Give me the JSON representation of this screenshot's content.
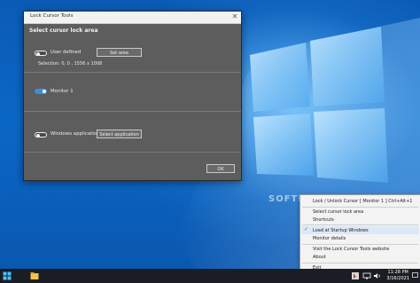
{
  "window": {
    "title": "Lock Cursor Tools",
    "section_title": "Select cursor lock area",
    "rows": {
      "user_defined_label": "User defined",
      "set_area_label": "Set area",
      "selection_text": "Selection: 0, 0 , 1556 x 1008",
      "monitor_label": "Monitor 1",
      "windows_app_label": "Windows application",
      "select_app_label": "Select application"
    },
    "ok_label": "OK"
  },
  "watermark": "SOFTPEDIA",
  "menu": {
    "header": "Lock / Unlock Cursor [ Monitor 1 ] Ctrl+Alt+1",
    "items": [
      "Select cursor lock area",
      "Shortcuts",
      "Load at Startup Windows",
      "Monitor details",
      "Visit the Lock Cursor Tools website",
      "About",
      "Exit"
    ],
    "checked_index": 2,
    "check_glyph": "✓"
  },
  "taskbar": {
    "time": "11:28 PM",
    "date": "3/16/2021"
  },
  "colors": {
    "accent": "#3b8ee0",
    "window_bg": "#5d5d5d",
    "desktop": "#0b63c0"
  },
  "icons": [
    "windows-start-icon",
    "file-explorer-icon",
    "lock-cursor-tray-icon",
    "network-icon",
    "volume-icon",
    "notification-icon",
    "close-icon"
  ]
}
